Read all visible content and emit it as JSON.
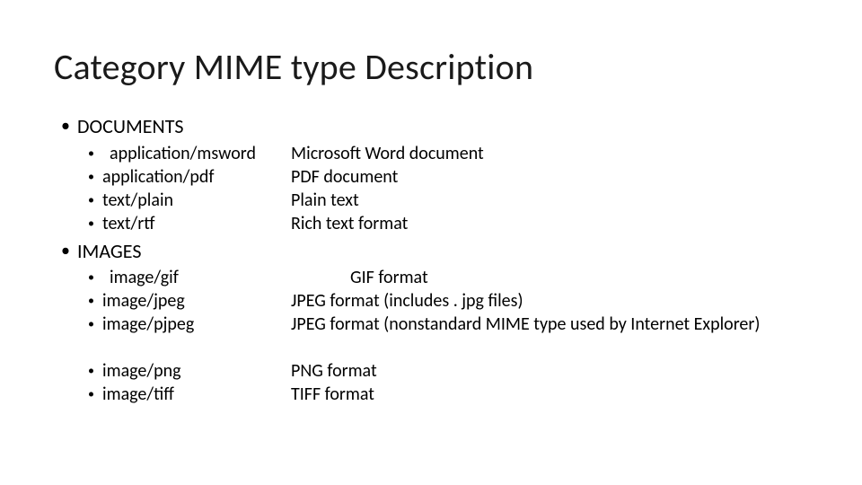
{
  "title": "Category MIME type Description",
  "categories": {
    "documents": {
      "label": "DOCUMENTS",
      "items": [
        {
          "mime": "application/msword",
          "desc": "Microsoft Word document",
          "indent": true
        },
        {
          "mime": "application/pdf",
          "desc": "PDF document"
        },
        {
          "mime": "text/plain",
          "desc": "Plain text"
        },
        {
          "mime": "text/rtf",
          "desc": "Rich text format"
        }
      ]
    },
    "images": {
      "label": "IMAGES",
      "items": [
        {
          "mime": "image/gif",
          "desc": "GIF format",
          "indent": true,
          "descIndent": true
        },
        {
          "mime": "image/jpeg",
          "desc": "JPEG format (includes . jpg files)"
        },
        {
          "mime": "image/pjpeg",
          "desc": "JPEG format (nonstandard MIME type used by Internet Explorer)"
        },
        {
          "blank": true
        },
        {
          "mime": "image/png",
          "desc": "PNG format"
        },
        {
          "mime": "image/tiff",
          "desc": "TIFF format"
        }
      ]
    }
  },
  "bullet": "•"
}
